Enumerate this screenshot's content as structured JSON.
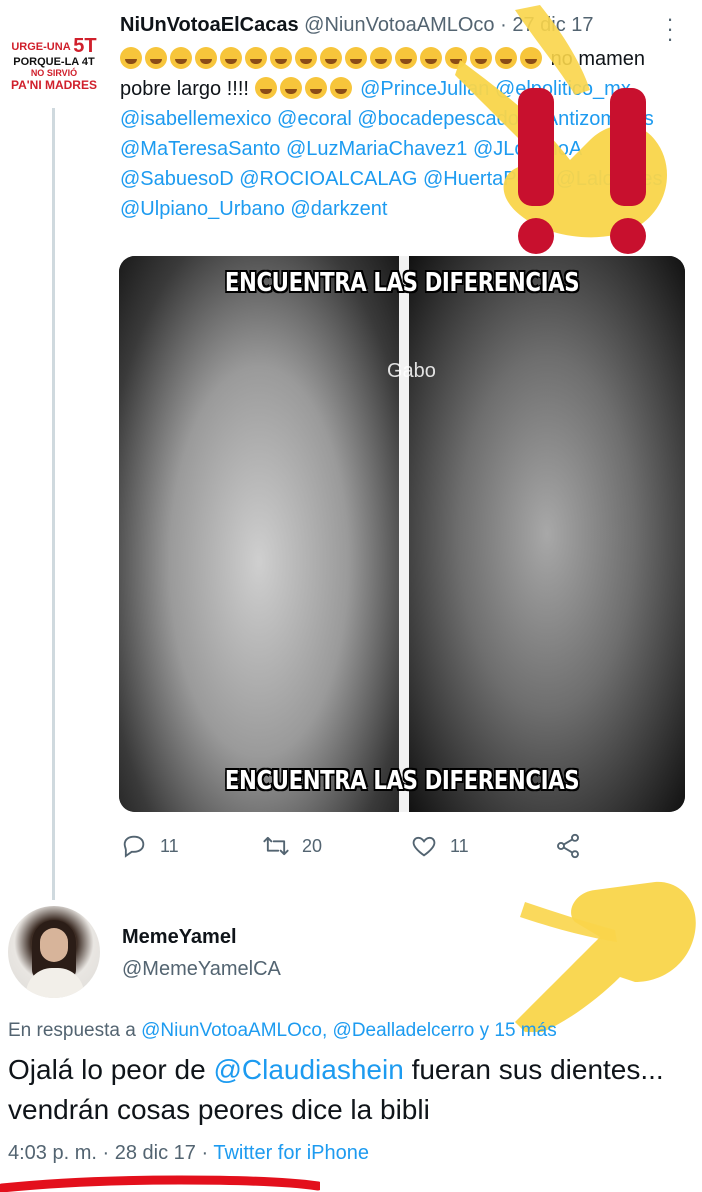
{
  "tweet1": {
    "avatar_text": {
      "line1_pre": "URGE-UNA",
      "line1_big": "5T",
      "line2": "PORQUE-LA 4T",
      "line3": "NO SIRVIÓ",
      "line4": "PA'NI MADRES"
    },
    "name": "NiUnVotoaElCacas",
    "handle": "@NiunVotoaAMLOco",
    "separator": "·",
    "date": "27 dic 17",
    "more_icon": "more-vertical-icon",
    "text_part1": "no mamen pobre largo !!!!",
    "mentions_line1": "@PrinceJulian",
    "mentions": "@elpolitico_mx @isabellemexico @ecoral @bocadepescado @Antizombies @MaTeresaSanto @LuzMariaChavez1 @JLozanoA @SabuesoD @ROCIOALCALAG @HuertaPepe @Laloflores @Ulpiano_Urbano @darkzent",
    "media": {
      "caption_top": "ENCUENTRA LAS DIFERENCIAS",
      "caption_bottom": "ENCUENTRA LAS DIFERENCIAS",
      "watermark": "Gabo"
    },
    "actions": {
      "reply_icon": "reply-icon",
      "reply_count": "11",
      "retweet_icon": "retweet-icon",
      "retweet_count": "20",
      "like_icon": "heart-icon",
      "like_count": "11",
      "share_icon": "share-icon"
    }
  },
  "tweet2": {
    "name": "MemeYamel",
    "handle": "@MemeYamelCA",
    "reply_prefix": "En respuesta a",
    "reply_mentions": "@NiunVotoaAMLOco, @Dealladelcerro",
    "reply_suffix": "y 15 más",
    "text_pre": "Ojalá lo peor de",
    "text_mention": "@Claudiashein",
    "text_post": "fueran sus dientes... vendrán cosas peores dice la bibli",
    "time": "4:03 p. m.",
    "separator": "·",
    "date": "28 dic 17",
    "source": "Twitter for iPhone"
  },
  "colors": {
    "link": "#1d9bf0",
    "muted": "#536471",
    "overlay_yellow": "#f9d54a",
    "overlay_red": "#c8102e"
  }
}
